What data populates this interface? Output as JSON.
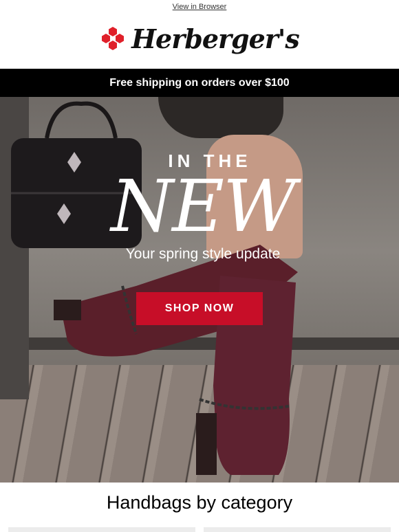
{
  "topbar": {
    "view_in_browser": "View in Browser"
  },
  "brand": {
    "name": "Herberger's",
    "accent": "#e0202a"
  },
  "shipping_bar": {
    "text": "Free shipping on orders over $100"
  },
  "hero": {
    "kicker": "IN THE",
    "headline": "NEW",
    "subtitle": "Your spring style update",
    "cta": "SHOP NOW",
    "cta_color": "#c70e28"
  },
  "section": {
    "title": "Handbags by category"
  }
}
